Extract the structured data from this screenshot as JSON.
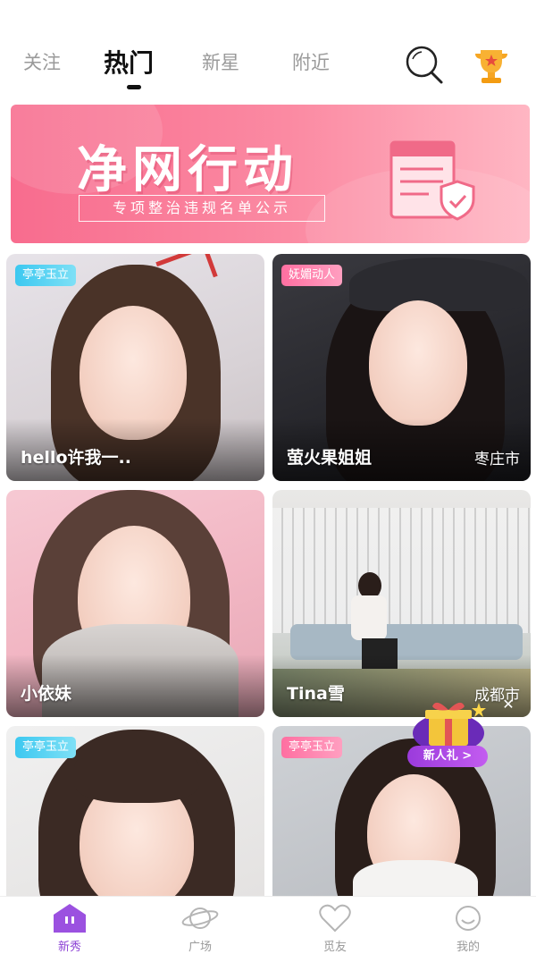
{
  "top_tabs": [
    {
      "label": "关注",
      "active": false
    },
    {
      "label": "热门",
      "active": true
    },
    {
      "label": "新星",
      "active": false
    },
    {
      "label": "附近",
      "active": false
    }
  ],
  "icons": {
    "search": "search-icon",
    "trophy": "trophy-icon"
  },
  "banner": {
    "title": "净网行动",
    "subtitle": "专项整治违规名单公示"
  },
  "cards": [
    {
      "badge": "亭亭玉立",
      "badge_color": "#3cc8f0",
      "name": "hello许我一..",
      "city": ""
    },
    {
      "badge": "妩媚动人",
      "badge_color": "#ff6fa1",
      "name": "萤火果姐姐",
      "city": "枣庄市"
    },
    {
      "badge": "",
      "badge_color": "",
      "name": "小依妹",
      "city": ""
    },
    {
      "badge": "",
      "badge_color": "",
      "name": "Tina雪",
      "city": "成都市"
    },
    {
      "badge": "亭亭玉立",
      "badge_color": "#3cc8f0",
      "name": "",
      "city": ""
    },
    {
      "badge": "亭亭玉立",
      "badge_color": "#ff6fa1",
      "name": "",
      "city": ""
    }
  ],
  "gift_popup": {
    "label": "新人礼 >",
    "close": "✕"
  },
  "bottom_nav": [
    {
      "label": "新秀",
      "icon": "home-icon",
      "active": true
    },
    {
      "label": "广场",
      "icon": "planet-icon",
      "active": false
    },
    {
      "label": "觅友",
      "icon": "heart-icon",
      "active": false
    },
    {
      "label": "我的",
      "icon": "profile-icon",
      "active": false
    }
  ],
  "colors": {
    "accent": "#8e44d6",
    "banner": "#f86c8e"
  }
}
